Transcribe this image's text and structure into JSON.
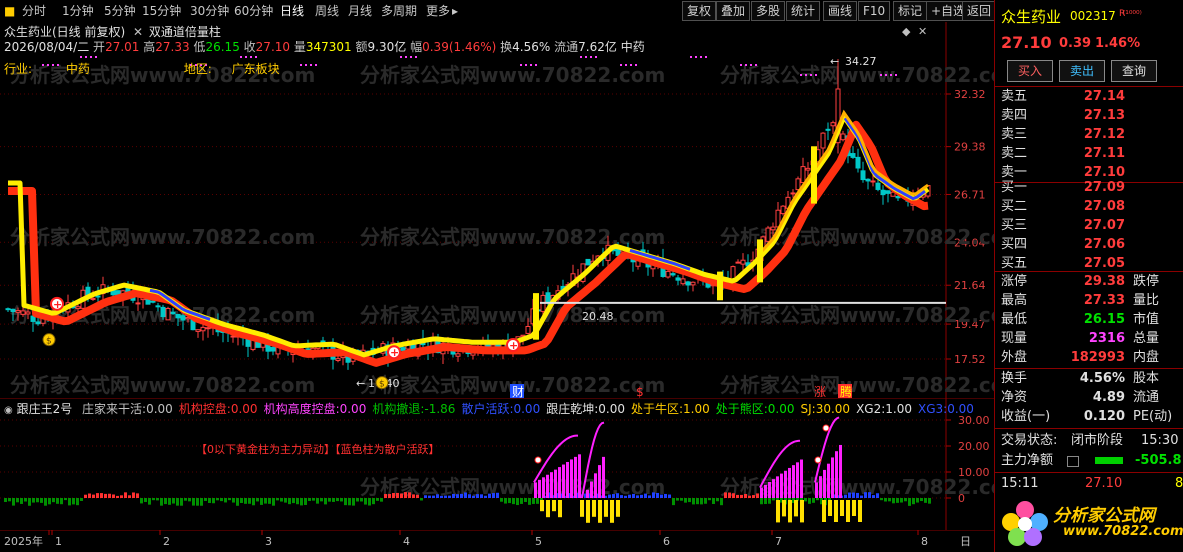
{
  "toolbar": {
    "periods": [
      "分时",
      "1分钟",
      "5分钟",
      "15分钟",
      "30分钟",
      "60分钟",
      "日线",
      "周线",
      "月线",
      "多周期",
      "更多"
    ],
    "active": "日线",
    "right_buttons": [
      "复权",
      "叠加",
      "多股",
      "统计",
      "画线",
      "F10",
      "标记",
      "+自选",
      "返回"
    ]
  },
  "chart": {
    "title": "众生药业(日线 前复权)",
    "indicator_name": "双通道倍量柱",
    "info": {
      "date": "2026/08/04/二",
      "open_label": "开",
      "open": "27.01",
      "high_label": "高",
      "high": "27.33",
      "low_label": "低",
      "low": "26.15",
      "close_label": "收",
      "close": "27.10",
      "vol_label": "量",
      "vol": "347301",
      "amt_label": "额",
      "amt": "9.30亿",
      "chg_label": "幅",
      "chg": "0.39(1.46%)",
      "turn_label": "换",
      "turn": "4.56%",
      "float_label": "流通",
      "float": "7.62亿",
      "sector": "中药"
    },
    "industry_label": "行业:",
    "industry": "中药",
    "region_label": "地区:",
    "region": "广东板块",
    "price_axis": [
      "32.32",
      "29.38",
      "26.71",
      "24.04",
      "21.64",
      "19.47",
      "17.52"
    ],
    "price_axis_values": [
      32.32,
      29.38,
      26.71,
      24.04,
      21.64,
      19.47,
      17.52
    ],
    "high_mark": "34.27",
    "low_mark": "16.40",
    "mid_mark": "20.48",
    "markers": {
      "cai": "财",
      "dollar": "$",
      "zhang": "涨",
      "teng": "腾"
    },
    "watermark": "分析家公式网www.70822.com"
  },
  "indicator": {
    "title": "跟庄王2号",
    "items": [
      {
        "label": "庄家来干活:",
        "value": "0.00",
        "color": "#c0c0c0"
      },
      {
        "label": "机构控盘:",
        "value": "0.00",
        "color": "#ff3030"
      },
      {
        "label": "机构高度控盘:",
        "value": "0.00",
        "color": "#ff44ff"
      },
      {
        "label": "机构撤退:",
        "value": "-1.86",
        "color": "#00c000"
      },
      {
        "label": "散户活跃:",
        "value": "0.00",
        "color": "#3050ff"
      },
      {
        "label": "跟庄乾坤:",
        "value": "0.00",
        "color": "#e0e0e0"
      },
      {
        "label": "处于牛区:",
        "value": "1.00",
        "color": "#ffcc00"
      },
      {
        "label": "处于熊区:",
        "value": "0.00",
        "color": "#00e000"
      },
      {
        "label": "SJ:",
        "value": "30.00",
        "color": "#ffcc00"
      },
      {
        "label": "XG2:",
        "value": "1.00",
        "color": "#e0e0e0"
      },
      {
        "label": "XG3:",
        "value": "0.00",
        "color": "#3050ff"
      }
    ],
    "note": "【0以下黄金柱为主力异动】【蓝色柱为散户活跃】",
    "axis": [
      "30.00",
      "20.00",
      "10.00",
      "0"
    ],
    "axis_values": [
      30,
      20,
      10,
      0
    ]
  },
  "time_axis": [
    "2025年",
    "1",
    "2",
    "3",
    "4",
    "5",
    "6",
    "7",
    "8"
  ],
  "time_axis_right": "日",
  "panel": {
    "name": "众生药业",
    "code": "002317",
    "badge": "R",
    "price": "27.10",
    "change": "0.39",
    "pct": "1.46%",
    "buy_btn": "买入",
    "sell_btn": "卖出",
    "query_btn": "查询",
    "asks": [
      {
        "label": "卖五",
        "price": "27.14"
      },
      {
        "label": "卖四",
        "price": "27.13"
      },
      {
        "label": "卖三",
        "price": "27.12"
      },
      {
        "label": "卖二",
        "price": "27.11"
      },
      {
        "label": "卖一",
        "price": "27.10"
      }
    ],
    "bids": [
      {
        "label": "买一",
        "price": "27.09"
      },
      {
        "label": "买二",
        "price": "27.08"
      },
      {
        "label": "买三",
        "price": "27.07"
      },
      {
        "label": "买四",
        "price": "27.06"
      },
      {
        "label": "买五",
        "price": "27.05"
      }
    ],
    "stats": [
      {
        "label": "涨停",
        "value": "29.38",
        "right": "跌停",
        "color": "#ff3c3c"
      },
      {
        "label": "最高",
        "value": "27.33",
        "right": "量比",
        "color": "#ff3c3c"
      },
      {
        "label": "最低",
        "value": "26.15",
        "right": "市值",
        "color": "#00e000"
      },
      {
        "label": "现量",
        "value": "2316",
        "right": "总量",
        "color": "#ff44ff"
      },
      {
        "label": "外盘",
        "value": "182993",
        "right": "内盘",
        "color": "#ff3c3c"
      }
    ],
    "stats2": [
      {
        "label": "换手",
        "value": "4.56%",
        "right": "股本"
      },
      {
        "label": "净资",
        "value": "4.89",
        "right": "流通"
      },
      {
        "label": "收益(一)",
        "value": "0.120",
        "right": "PE(动)"
      }
    ],
    "trade_status_label": "交易状态:",
    "trade_status": "闭市阶段",
    "trade_time": "15:30",
    "net_flow_label": "主力净额",
    "net_flow": "-505.8",
    "tick_time": "15:11",
    "tick_price": "27.10",
    "tick_vol": "8",
    "logo_text": "分析家公式网",
    "logo_url": "www.70822.com"
  }
}
